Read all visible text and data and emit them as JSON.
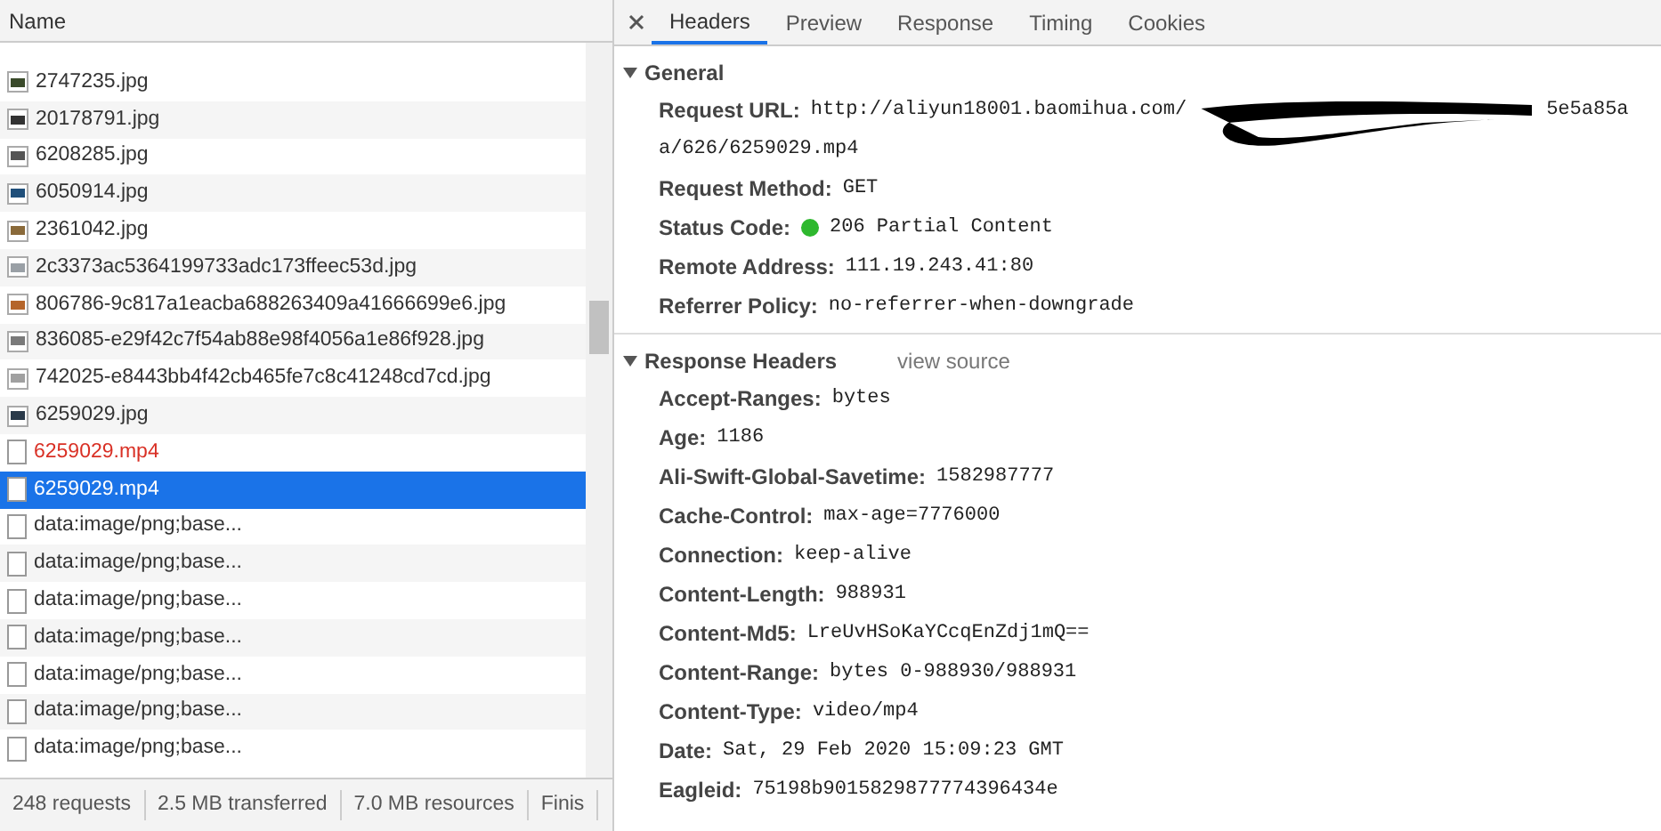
{
  "list": {
    "header": "Name",
    "rows": [
      {
        "name": "2747235.jpg",
        "kind": "image",
        "color": "#3a4a2a",
        "selected": false,
        "failed": false
      },
      {
        "name": "20178791.jpg",
        "kind": "image",
        "color": "#333333",
        "selected": false,
        "failed": false
      },
      {
        "name": "6208285.jpg",
        "kind": "image",
        "color": "#555555",
        "selected": false,
        "failed": false
      },
      {
        "name": "6050914.jpg",
        "kind": "image",
        "color": "#1f4f7a",
        "selected": false,
        "failed": false
      },
      {
        "name": "2361042.jpg",
        "kind": "image",
        "color": "#8a6a3a",
        "selected": false,
        "failed": false
      },
      {
        "name": "2c3373ac5364199733adc173ffeec53d.jpg",
        "kind": "image",
        "color": "#9aa0a6",
        "selected": false,
        "failed": false
      },
      {
        "name": "806786-9c817a1eacba688263409a41666699e6.jpg",
        "kind": "image",
        "color": "#b5652a",
        "selected": false,
        "failed": false
      },
      {
        "name": "836085-e29f42c7f54ab88e98f4056a1e86f928.jpg",
        "kind": "image",
        "color": "#7a7a7a",
        "selected": false,
        "failed": false
      },
      {
        "name": "742025-e8443bb4f42cb465fe7c8c41248cd7cd.jpg",
        "kind": "image",
        "color": "#a0a0a0",
        "selected": false,
        "failed": false
      },
      {
        "name": "6259029.jpg",
        "kind": "image",
        "color": "#2a3a4a",
        "selected": false,
        "failed": false
      },
      {
        "name": "6259029.mp4",
        "kind": "file",
        "selected": false,
        "failed": true
      },
      {
        "name": "6259029.mp4",
        "kind": "file",
        "selected": true,
        "failed": false
      },
      {
        "name": "data:image/png;base...",
        "kind": "file",
        "selected": false,
        "failed": false
      },
      {
        "name": "data:image/png;base...",
        "kind": "file",
        "selected": false,
        "failed": false
      },
      {
        "name": "data:image/png;base...",
        "kind": "file",
        "selected": false,
        "failed": false
      },
      {
        "name": "data:image/png;base...",
        "kind": "file",
        "selected": false,
        "failed": false
      },
      {
        "name": "data:image/png;base...",
        "kind": "file",
        "selected": false,
        "failed": false
      },
      {
        "name": "data:image/png;base...",
        "kind": "file",
        "selected": false,
        "failed": false
      },
      {
        "name": "data:image/png;base...",
        "kind": "file",
        "selected": false,
        "failed": false
      }
    ]
  },
  "status_bar": [
    "248 requests",
    "2.5 MB transferred",
    "7.0 MB resources",
    "Finis"
  ],
  "tabs": [
    {
      "label": "Headers",
      "selected": true
    },
    {
      "label": "Preview",
      "selected": false
    },
    {
      "label": "Response",
      "selected": false
    },
    {
      "label": "Timing",
      "selected": false
    },
    {
      "label": "Cookies",
      "selected": false
    }
  ],
  "sections": [
    {
      "title": "General",
      "expanded": true,
      "fields": [
        {
          "kind": "url",
          "label": "Request URL:",
          "value": "http://aliyun18001.baomihua.com/",
          "value_after": "5e5a85a",
          "value_wrapped": "a/626/6259029.mp4"
        },
        {
          "kind": "text",
          "label": "Request Method:",
          "value": "GET"
        },
        {
          "kind": "status",
          "label": "Status Code:",
          "value": "206 Partial Content",
          "color": "#2eb82e"
        },
        {
          "kind": "text",
          "label": "Remote Address:",
          "value": "111.19.243.41:80"
        },
        {
          "kind": "text",
          "label": "Referrer Policy:",
          "value": "no-referrer-when-downgrade"
        }
      ]
    },
    {
      "title": "Response Headers",
      "expanded": true,
      "link": "view source",
      "fields": [
        {
          "kind": "text",
          "label": "Accept-Ranges:",
          "value": "bytes"
        },
        {
          "kind": "text",
          "label": "Age:",
          "value": "1186"
        },
        {
          "kind": "text",
          "label": "Ali-Swift-Global-Savetime:",
          "value": "1582987777"
        },
        {
          "kind": "text",
          "label": "Cache-Control:",
          "value": "max-age=7776000"
        },
        {
          "kind": "text",
          "label": "Connection:",
          "value": "keep-alive"
        },
        {
          "kind": "text",
          "label": "Content-Length:",
          "value": "988931"
        },
        {
          "kind": "text",
          "label": "Content-Md5:",
          "value": "LreUvHSoKaYCcqEnZdj1mQ=="
        },
        {
          "kind": "text",
          "label": "Content-Range:",
          "value": "bytes 0-988930/988931"
        },
        {
          "kind": "text",
          "label": "Content-Type:",
          "value": "video/mp4"
        },
        {
          "kind": "text",
          "label": "Date:",
          "value": "Sat, 29 Feb 2020 15:09:23 GMT"
        },
        {
          "kind": "text",
          "label": "Eagleid:",
          "value": "75198b9015829877774396434e"
        }
      ]
    }
  ]
}
